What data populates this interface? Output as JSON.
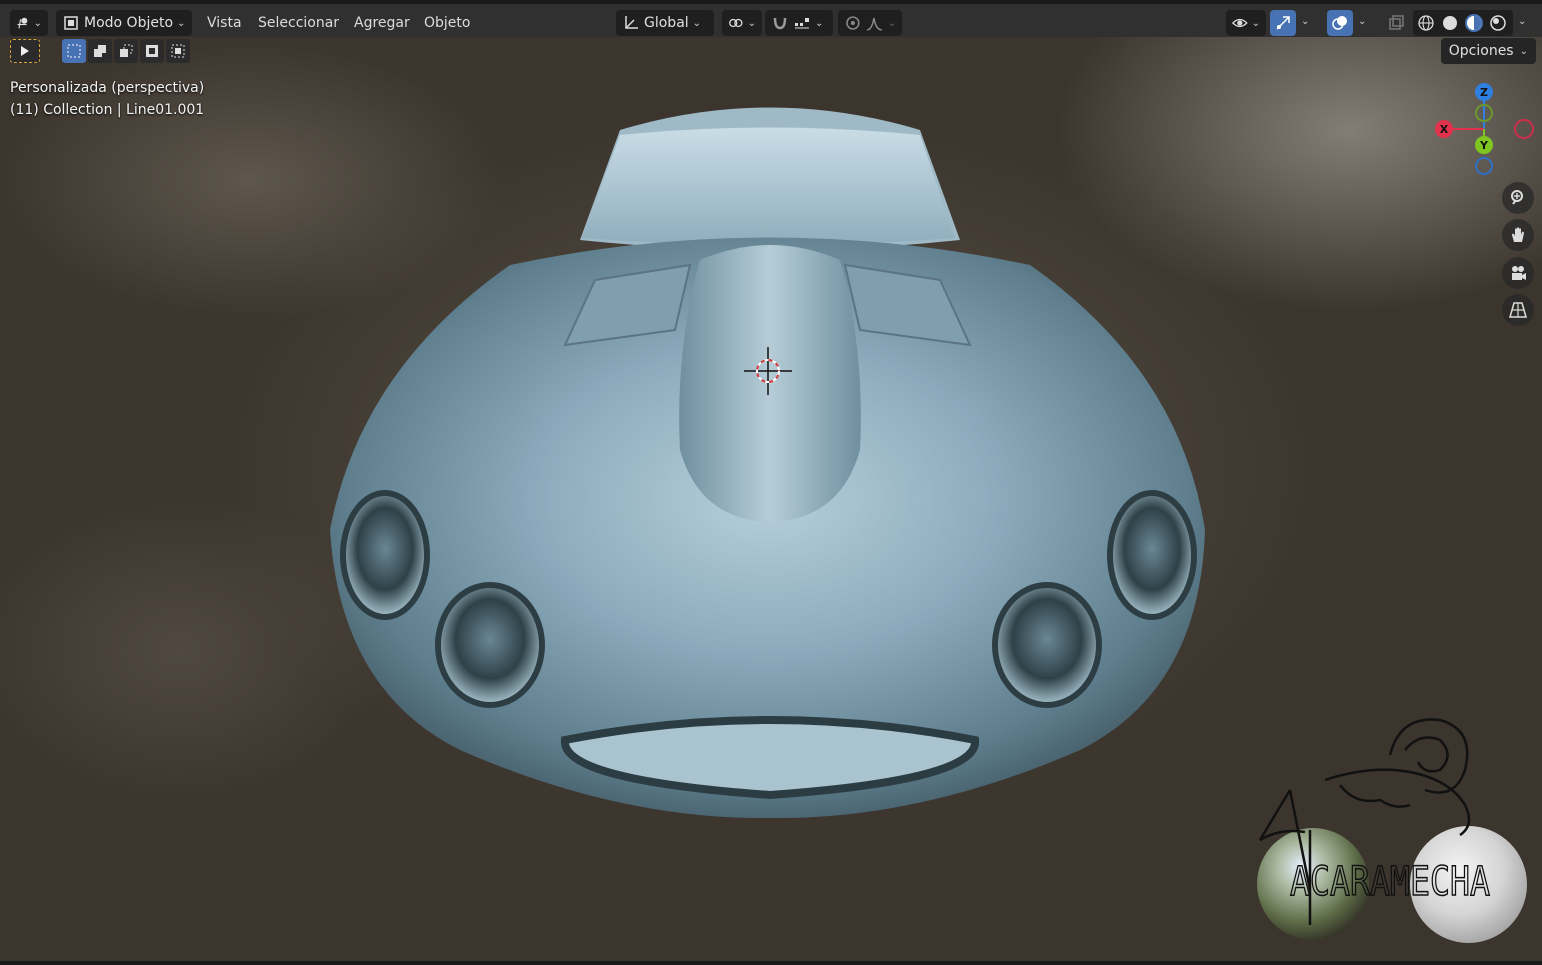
{
  "header": {
    "mode_label": "Modo Objeto",
    "menus": [
      "Vista",
      "Seleccionar",
      "Agregar",
      "Objeto"
    ],
    "transform_orientation": "Global",
    "options_label": "Opciones"
  },
  "overlay": {
    "view_name": "Personalizada (perspectiva)",
    "collection_info": "(11) Collection | Line01.001"
  },
  "gizmo": {
    "x_label": "X",
    "y_label": "Y",
    "z_label": "Z",
    "colors": {
      "x": "#e0324d",
      "y": "#7fc620",
      "z": "#2f7fe0"
    }
  },
  "watermark": {
    "text": "ACARAMECHA"
  },
  "colors": {
    "header_bg": "#303030",
    "accent": "#4772b3",
    "car_body": "#8fb2c4"
  },
  "icons": {
    "editor_type": "editor-type-icon",
    "object_mode": "object-mode-icon",
    "transform_orientation": "transform-orientation-icon",
    "pivot": "pivot-point-icon",
    "snap": "snap-magnet-icon",
    "snap_increment": "snap-increment-icon",
    "proportional": "proportional-edit-icon",
    "falloff": "falloff-curve-icon",
    "visibility": "visibility-eye-icon",
    "gizmos": "gizmo-toggle-icon",
    "overlays": "overlays-icon",
    "xray": "xray-icon",
    "shading": [
      "wireframe-shading-icon",
      "solid-shading-icon",
      "material-shading-icon",
      "rendered-shading-icon"
    ],
    "nav": [
      "zoom-icon",
      "pan-hand-icon",
      "camera-icon",
      "perspective-grid-icon"
    ]
  }
}
